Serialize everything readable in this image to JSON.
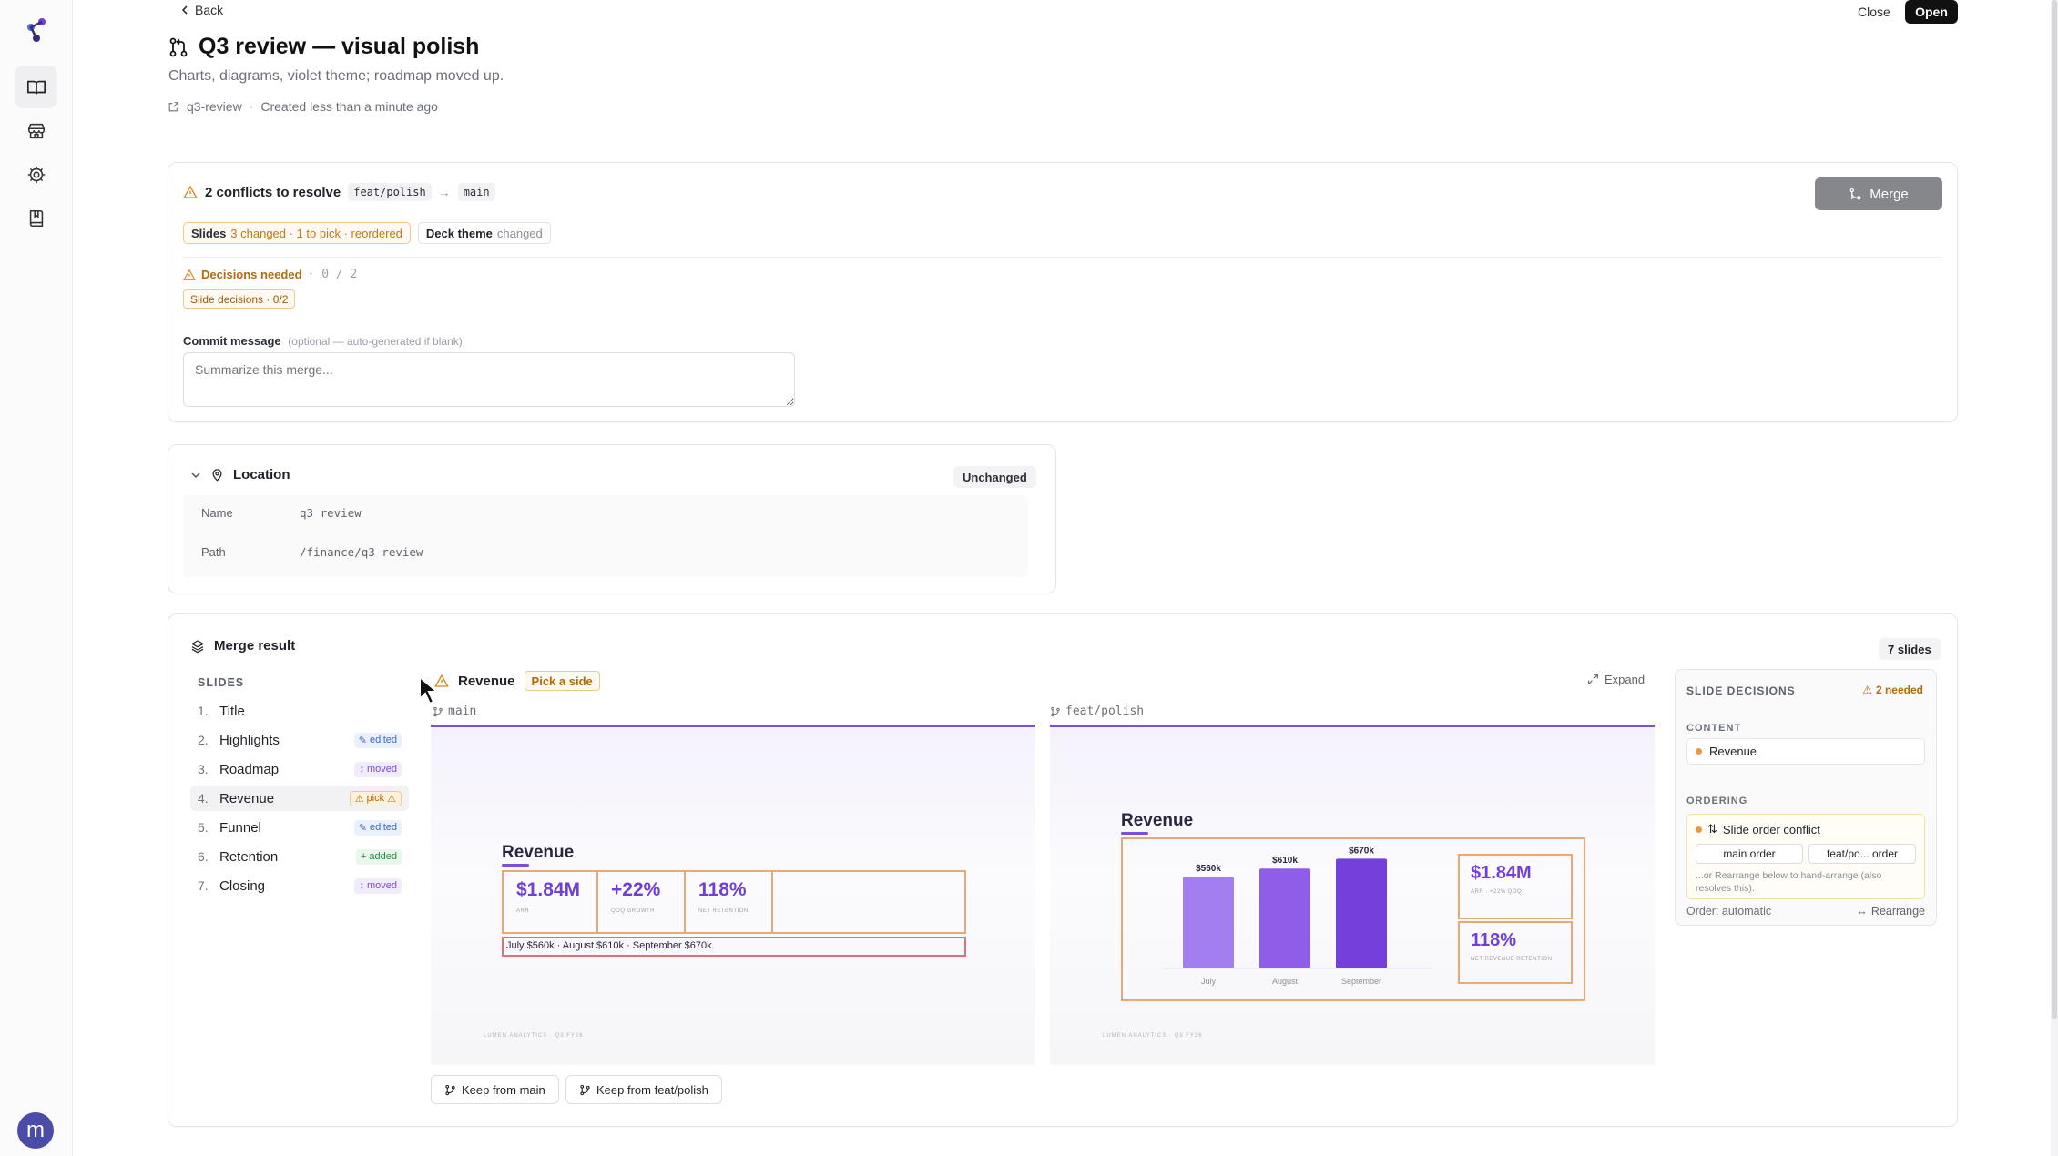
{
  "header": {
    "back_label": "Back",
    "title": "Q3 review — visual polish",
    "subtitle": "Charts, diagrams, violet theme; roadmap moved up.",
    "link_label": "q3-review",
    "separator": "·",
    "created": "Created less than a minute ago",
    "close_label": "Close",
    "open_label": "Open"
  },
  "conflicts": {
    "title": "2 conflicts to resolve",
    "source_branch": "feat/polish",
    "arrow": "→",
    "target_branch": "main",
    "merge_label": "Merge",
    "slides_tag_label": "Slides",
    "slides_tag_detail": "3 changed · 1 to pick · reordered",
    "theme_tag_label": "Deck theme",
    "theme_tag_detail": "changed",
    "decisions_label": "Decisions needed",
    "decisions_count": "· 0 / 2",
    "slide_decisions_tag": "Slide decisions · 0/2",
    "commit_label": "Commit message",
    "commit_hint": "(optional — auto-generated if blank)",
    "commit_placeholder": "Summarize this merge..."
  },
  "location": {
    "title": "Location",
    "status": "Unchanged",
    "rows": [
      {
        "key": "Name",
        "value": "q3 review"
      },
      {
        "key": "Path",
        "value": "/finance/q3-review"
      }
    ]
  },
  "merge_result": {
    "title": "Merge result",
    "count_badge": "7 slides",
    "slides_heading": "SLIDES",
    "slides": [
      {
        "num": "1.",
        "name": "Title",
        "badge": "",
        "badge_type": ""
      },
      {
        "num": "2.",
        "name": "Highlights",
        "badge": "edited",
        "badge_type": "edited"
      },
      {
        "num": "3.",
        "name": "Roadmap",
        "badge": "moved",
        "badge_type": "moved"
      },
      {
        "num": "4.",
        "name": "Revenue",
        "badge": "pick",
        "badge_type": "pick"
      },
      {
        "num": "5.",
        "name": "Funnel",
        "badge": "edited",
        "badge_type": "edited"
      },
      {
        "num": "6.",
        "name": "Retention",
        "badge": "added",
        "badge_type": "added"
      },
      {
        "num": "7.",
        "name": "Closing",
        "badge": "moved",
        "badge_type": "moved"
      }
    ],
    "current_slide": "Revenue",
    "pick_tag": "Pick a side",
    "expand_label": "Expand",
    "main_label": "main",
    "feat_label": "feat/polish",
    "keep_main": "Keep from main",
    "keep_feat": "Keep from feat/polish"
  },
  "preview_main": {
    "title": "Revenue",
    "kpis": [
      {
        "value": "$1.84M",
        "label": "ARR"
      },
      {
        "value": "+22%",
        "label": "QOQ GROWTH"
      },
      {
        "value": "118%",
        "label": "NET RETENTION"
      }
    ],
    "months_text": "July $560k · August $610k · September $670k.",
    "footer": "LUMEN ANALYTICS · Q3 FY26"
  },
  "preview_feat": {
    "title": "Revenue",
    "kpis": [
      {
        "value": "$1.84M",
        "label": "ARR · +22% QOQ"
      },
      {
        "value": "118%",
        "label": "NET REVENUE RETENTION"
      }
    ],
    "footer": "LUMEN ANALYTICS · Q3 FY26"
  },
  "chart_data": {
    "type": "bar",
    "categories": [
      "July",
      "August",
      "September"
    ],
    "values": [
      560,
      610,
      670
    ],
    "data_labels": [
      "$560k",
      "$610k",
      "$670k"
    ],
    "title": "",
    "xlabel": "",
    "ylabel": "",
    "colors": [
      "#a27ef0",
      "#8e5ee8",
      "#7440dc"
    ]
  },
  "slide_decisions": {
    "title": "SLIDE DECISIONS",
    "needed": "2 needed",
    "content_heading": "CONTENT",
    "content_item": "Revenue",
    "ordering_heading": "ORDERING",
    "order_conflict": "Slide order conflict",
    "main_order": "main order",
    "feat_order": "feat/po... order",
    "hint": "...or Rearrange below to hand-arrange (also resolves this).",
    "order_status": "Order: automatic",
    "rearrange_label": "Rearrange"
  },
  "user": {
    "avatar_letter": "m"
  }
}
